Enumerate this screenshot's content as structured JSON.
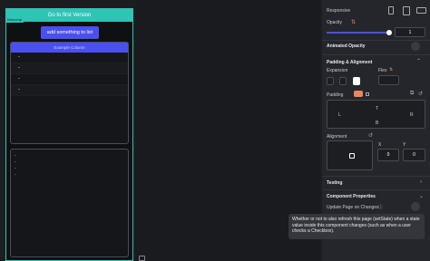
{
  "preview": {
    "tag": "Netcomp",
    "top_button": "Go to first Version",
    "add_button": "add something to list",
    "column_header": "Example Column",
    "column_rows": [
      "-",
      "-",
      "-",
      "-"
    ],
    "list_items": [
      "-",
      "-",
      "-",
      "-"
    ]
  },
  "panel": {
    "responsive_label": "Responsive",
    "opacity_label": "Opacity",
    "opacity_value": "1",
    "opacity_level": 1.0,
    "animated_opacity_label": "Animated Opacity",
    "padding_alignment_title": "Padding & Alignment",
    "expansion_label": "Expansion",
    "flex_label": "Flex",
    "padding_label": "Padding",
    "padding_top": "T",
    "padding_left": "L",
    "padding_right": "R",
    "padding_bottom": "B",
    "alignment_label": "Alignment",
    "align_x_label": "X",
    "align_y_label": "Y",
    "align_x_value": "0",
    "align_y_value": "0",
    "testing_label": "Testing",
    "component_properties_label": "Component Properties",
    "update_page_label": "Update Page on Changes",
    "tooltip": "Whether or not to also refresh this page (setState) when a state value inside this component changes (such as when a user checks a Checkbox)."
  },
  "colors": {
    "accent_teal": "#2ec4b6",
    "accent_blue": "#4a4ff0",
    "accent_orange": "#e8875a"
  }
}
